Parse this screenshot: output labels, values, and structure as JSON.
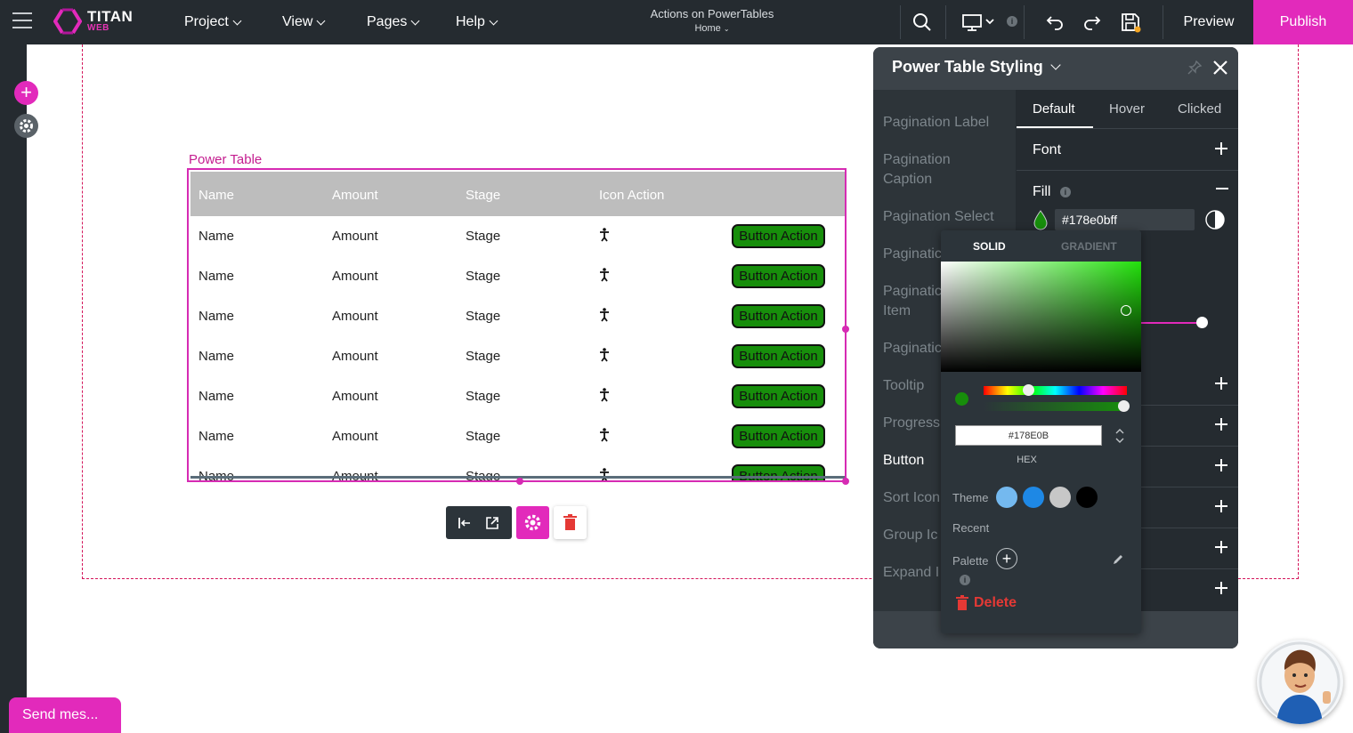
{
  "app": {
    "logo_name": "TITAN",
    "logo_sub": "WEB",
    "menu": [
      {
        "label": "Project"
      },
      {
        "label": "View"
      },
      {
        "label": "Pages"
      },
      {
        "label": "Help"
      }
    ],
    "doc_title": "Actions on PowerTables",
    "page_name": "Home",
    "device_info": "i",
    "preview_label": "Preview",
    "publish_label": "Publish",
    "accent_color": "#e22abb"
  },
  "power_table": {
    "label": "Power Table",
    "headers": [
      "Name",
      "Amount",
      "Stage",
      "Icon Action"
    ],
    "rows": [
      {
        "name": "Name",
        "amount": "Amount",
        "stage": "Stage",
        "button": "Button Action"
      },
      {
        "name": "Name",
        "amount": "Amount",
        "stage": "Stage",
        "button": "Button Action"
      },
      {
        "name": "Name",
        "amount": "Amount",
        "stage": "Stage",
        "button": "Button Action"
      },
      {
        "name": "Name",
        "amount": "Amount",
        "stage": "Stage",
        "button": "Button Action"
      },
      {
        "name": "Name",
        "amount": "Amount",
        "stage": "Stage",
        "button": "Button Action"
      },
      {
        "name": "Name",
        "amount": "Amount",
        "stage": "Stage",
        "button": "Button Action"
      },
      {
        "name": "Name",
        "amount": "Amount",
        "stage": "Stage",
        "button": "Button Action"
      }
    ],
    "icon_name": "person-icon",
    "button_color": "#178e0b"
  },
  "panel": {
    "title": "Power Table Styling",
    "side_items": [
      {
        "label": "Pagination Label"
      },
      {
        "label": "Pagination Caption"
      },
      {
        "label": "Pagination Select"
      },
      {
        "label": "Paginatic"
      },
      {
        "label": "Paginatic Item"
      },
      {
        "label": "Paginatic"
      },
      {
        "label": "Tooltip"
      },
      {
        "label": "Progress"
      },
      {
        "label": "Button"
      },
      {
        "label": "Sort Icon"
      },
      {
        "label": "Group Ic"
      },
      {
        "label": "Expand I"
      }
    ],
    "tabs": [
      "Default",
      "Hover",
      "Clicked"
    ],
    "font_label": "Font",
    "fill_label": "Fill",
    "fill_info": "i",
    "fill_value": "#178e0bff"
  },
  "picker": {
    "tab_solid": "SOLID",
    "tab_gradient": "GRADIENT",
    "hex_value": "#178E0B",
    "hex_label": "HEX",
    "theme_label": "Theme",
    "theme_colors": [
      "#74b9ef",
      "#1e88e5",
      "#c7c7c7",
      "#000000"
    ],
    "recent_label": "Recent",
    "palette_label": "Palette",
    "palette_info": "i",
    "delete_label": "Delete"
  },
  "chat": {
    "label": "Send mes..."
  }
}
